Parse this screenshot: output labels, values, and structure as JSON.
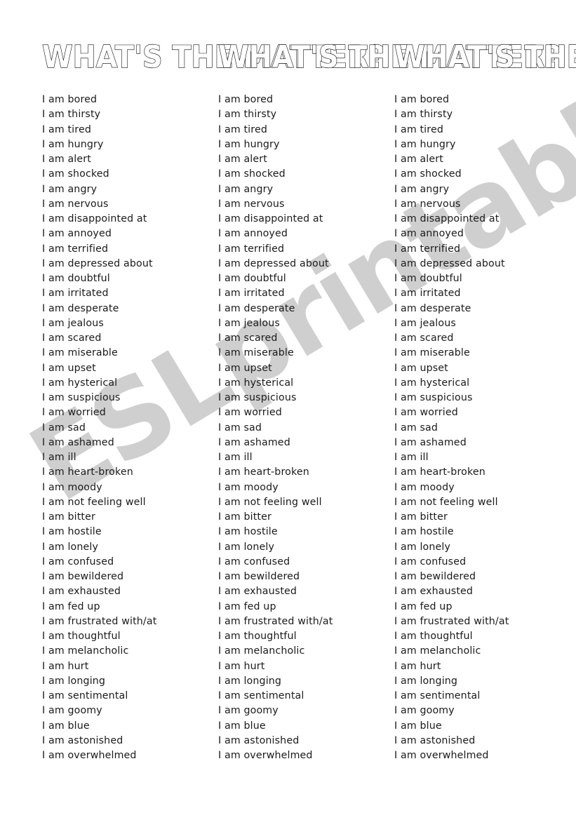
{
  "document": {
    "type": "esl-worksheet",
    "title": "WHAT'S THE MATTER?",
    "column_count": 3,
    "watermark": {
      "text": "ESLprintables.com",
      "color": "#cfcfcf",
      "rotation_degrees": -31
    },
    "background_color": "#ffffff",
    "text_color": "#1a1a1a"
  },
  "phrases": [
    "I am bored",
    "I am thirsty",
    "I am tired",
    "I am hungry",
    "I am alert",
    "I am shocked",
    "I am angry",
    "I am nervous",
    "I am disappointed at",
    "I am annoyed",
    "I am terrified",
    "I am depressed about",
    "I am doubtful",
    "I am irritated",
    "I am desperate",
    "I am jealous",
    "I am scared",
    "I am miserable",
    "I am upset",
    "I am hysterical",
    "I am suspicious",
    "I am worried",
    "I am sad",
    "I am ashamed",
    "I am ill",
    "I am heart-broken",
    "I am moody",
    "I am not feeling well",
    "I am bitter",
    "I am hostile",
    "I am lonely",
    "I am confused",
    "I am bewildered",
    "I am exhausted",
    "I am fed up",
    "I am frustrated with/at",
    "I am thoughtful",
    "I am melancholic",
    "I am hurt",
    "I am longing",
    "I am sentimental",
    "I am goomy",
    "I am blue",
    "I am astonished",
    "I am overwhelmed"
  ]
}
